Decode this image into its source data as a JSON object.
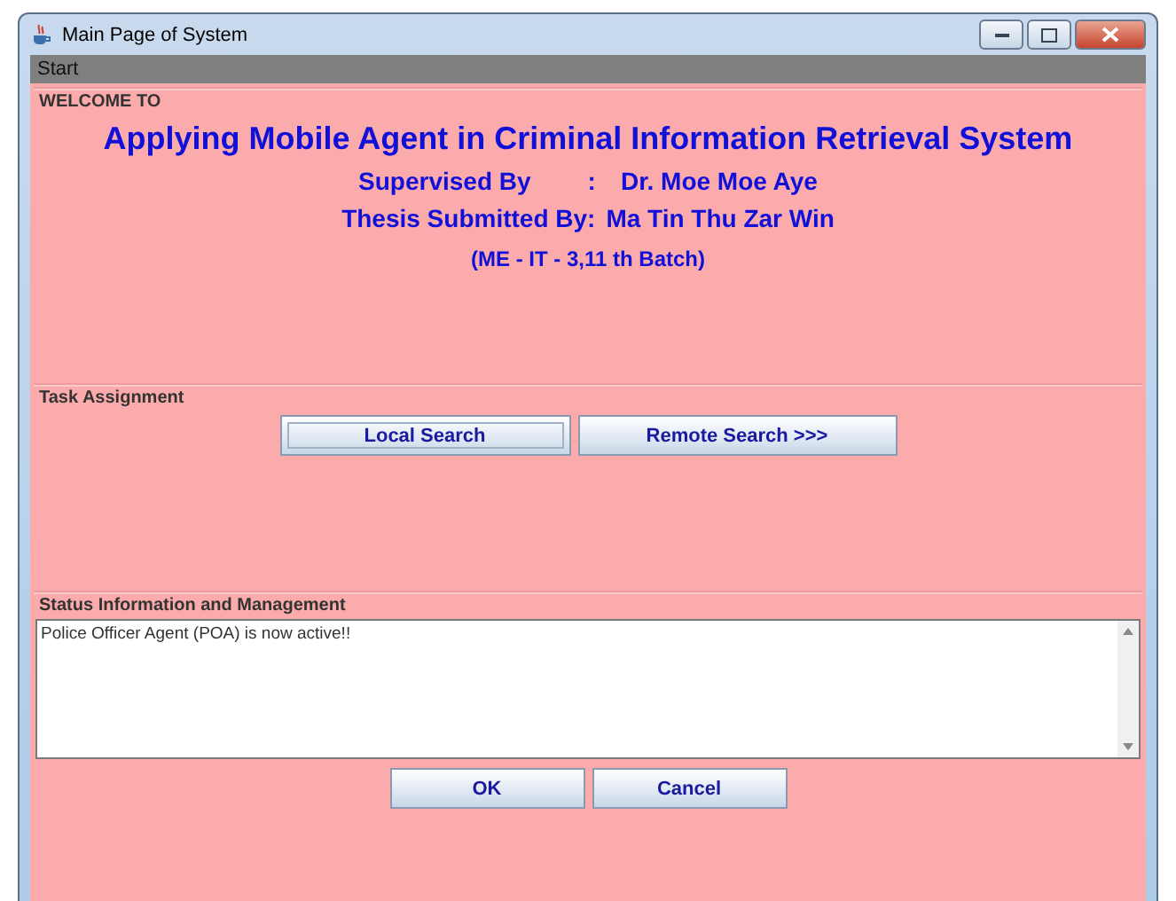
{
  "window": {
    "title": "Main Page of System"
  },
  "menu_bar": {
    "items": [
      "Start"
    ]
  },
  "welcome": {
    "title": "WELCOME TO",
    "heading": "Applying Mobile Agent in Criminal Information Retrieval System",
    "supervisor_label": "Supervised By",
    "separator": ":",
    "supervisor": "Dr. Moe Moe Aye",
    "thesis_label": "Thesis Submitted By:",
    "author": "Ma Tin Thu Zar Win",
    "batch": "(ME - IT - 3,11 th Batch)"
  },
  "task_assignment": {
    "title": "Task Assignment",
    "buttons": [
      {
        "label": "Local Search",
        "focused": true
      },
      {
        "label": "Remote Search >>>",
        "focused": false
      }
    ]
  },
  "status": {
    "title": "Status Information and Management",
    "log": "Police Officer Agent (POA) is now active!!"
  },
  "buttons": [
    {
      "label": "OK"
    },
    {
      "label": "Cancel"
    }
  ]
}
